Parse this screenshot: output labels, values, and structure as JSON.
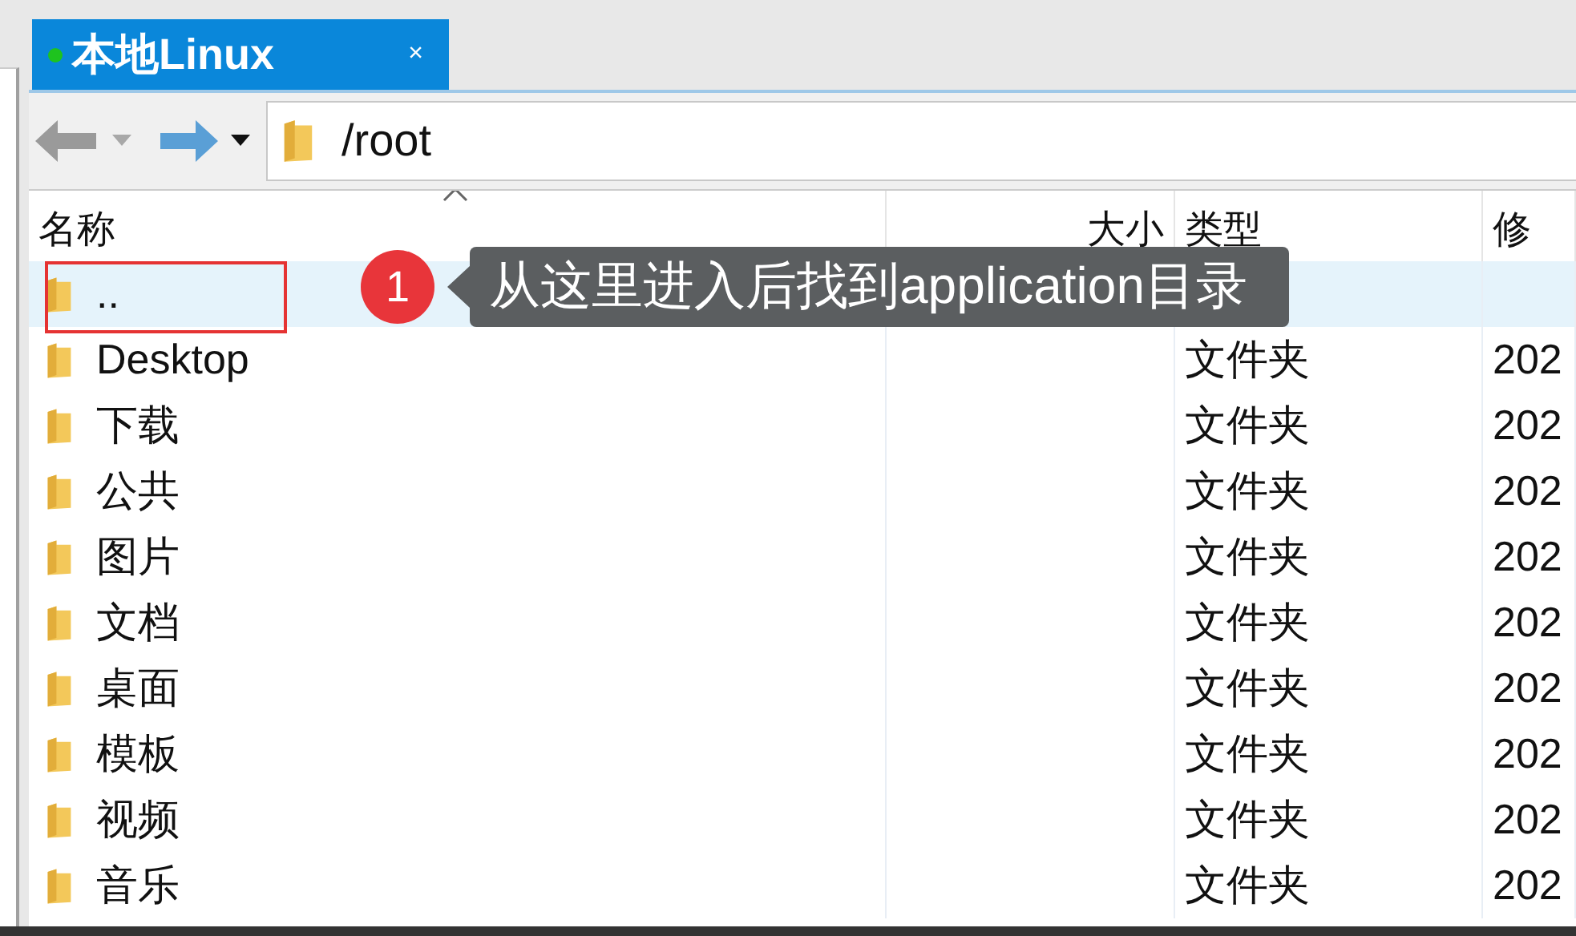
{
  "tabs": [
    {
      "label": "本地Linux",
      "selected": true,
      "close": "×"
    }
  ],
  "address": {
    "path": "/root"
  },
  "columns": [
    {
      "label": "名称",
      "sorted": true
    },
    {
      "label": "大小",
      "sorted": false
    },
    {
      "label": "类型",
      "sorted": false
    },
    {
      "label": "修",
      "sorted": false
    }
  ],
  "rows": [
    {
      "name": "..",
      "size": "",
      "type": "",
      "modified": "",
      "selected": true,
      "highlighted": true
    },
    {
      "name": "Desktop",
      "type": "文件夹",
      "modified": "202",
      "selected": false,
      "highlighted": false
    },
    {
      "name": "下载",
      "type": "文件夹",
      "modified": "202",
      "selected": false,
      "highlighted": false
    },
    {
      "name": "公共",
      "type": "文件夹",
      "modified": "202",
      "selected": false,
      "highlighted": false
    },
    {
      "name": "图片",
      "type": "文件夹",
      "modified": "202",
      "selected": false,
      "highlighted": false
    },
    {
      "name": "文档",
      "type": "文件夹",
      "modified": "202",
      "selected": false,
      "highlighted": false
    },
    {
      "name": "桌面",
      "type": "文件夹",
      "modified": "202",
      "selected": false,
      "highlighted": false
    },
    {
      "name": "模板",
      "type": "文件夹",
      "modified": "202",
      "selected": false,
      "highlighted": false
    },
    {
      "name": "视频",
      "type": "文件夹",
      "modified": "202",
      "selected": false,
      "highlighted": false
    },
    {
      "name": "音乐",
      "type": "文件夹",
      "modified": "202",
      "selected": false,
      "highlighted": false
    }
  ],
  "callout": {
    "number": "1",
    "text": "从这里进入后找到application目录"
  }
}
